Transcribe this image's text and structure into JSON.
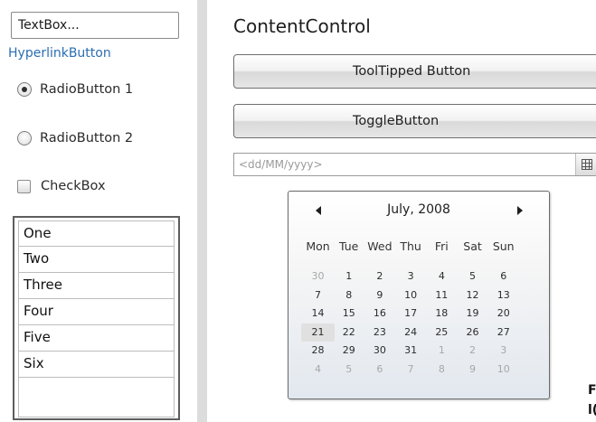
{
  "left_panel": {
    "textbox_value": "TextBox...",
    "hyperlink_label": "HyperlinkButton",
    "radio1_label": "RadioButton 1",
    "radio1_checked": true,
    "radio2_label": "RadioButton 2",
    "radio2_checked": false,
    "checkbox_label": "CheckBox",
    "checkbox_checked": false,
    "list_items": [
      "One",
      "Two",
      "Three",
      "Four",
      "Five",
      "Six"
    ]
  },
  "right_panel": {
    "content_control_label": "ContentControl",
    "tooltipped_button_label": "ToolTipped Button",
    "toggle_button_label": "ToggleButton",
    "date_placeholder": "<dd/MM/yyyy>",
    "calendar": {
      "month_year": "July, 2008",
      "days_of_week": [
        "Mon",
        "Tue",
        "Wed",
        "Thu",
        "Fri",
        "Sat",
        "Sun"
      ],
      "weeks": [
        [
          {
            "d": "30",
            "muted": true
          },
          {
            "d": "1"
          },
          {
            "d": "2"
          },
          {
            "d": "3"
          },
          {
            "d": "4"
          },
          {
            "d": "5"
          },
          {
            "d": "6"
          }
        ],
        [
          {
            "d": "7"
          },
          {
            "d": "8"
          },
          {
            "d": "9"
          },
          {
            "d": "10"
          },
          {
            "d": "11"
          },
          {
            "d": "12"
          },
          {
            "d": "13"
          }
        ],
        [
          {
            "d": "14"
          },
          {
            "d": "15"
          },
          {
            "d": "16"
          },
          {
            "d": "17"
          },
          {
            "d": "18"
          },
          {
            "d": "19"
          },
          {
            "d": "20"
          }
        ],
        [
          {
            "d": "21",
            "today": true
          },
          {
            "d": "22"
          },
          {
            "d": "23"
          },
          {
            "d": "24"
          },
          {
            "d": "25"
          },
          {
            "d": "26"
          },
          {
            "d": "27"
          }
        ],
        [
          {
            "d": "28"
          },
          {
            "d": "29"
          },
          {
            "d": "30"
          },
          {
            "d": "31"
          },
          {
            "d": "1",
            "muted": true
          },
          {
            "d": "2",
            "muted": true
          },
          {
            "d": "3",
            "muted": true
          }
        ],
        [
          {
            "d": "4",
            "muted": true
          },
          {
            "d": "5",
            "muted": true
          },
          {
            "d": "6",
            "muted": true
          },
          {
            "d": "7",
            "muted": true
          },
          {
            "d": "8",
            "muted": true
          },
          {
            "d": "9",
            "muted": true
          },
          {
            "d": "10",
            "muted": true
          }
        ]
      ]
    }
  },
  "corner_fragment": {
    "line1": "F",
    "line2": "l("
  },
  "colors": {
    "hyperlink": "#2a6eb2",
    "splitter": "#dcdcdc"
  }
}
